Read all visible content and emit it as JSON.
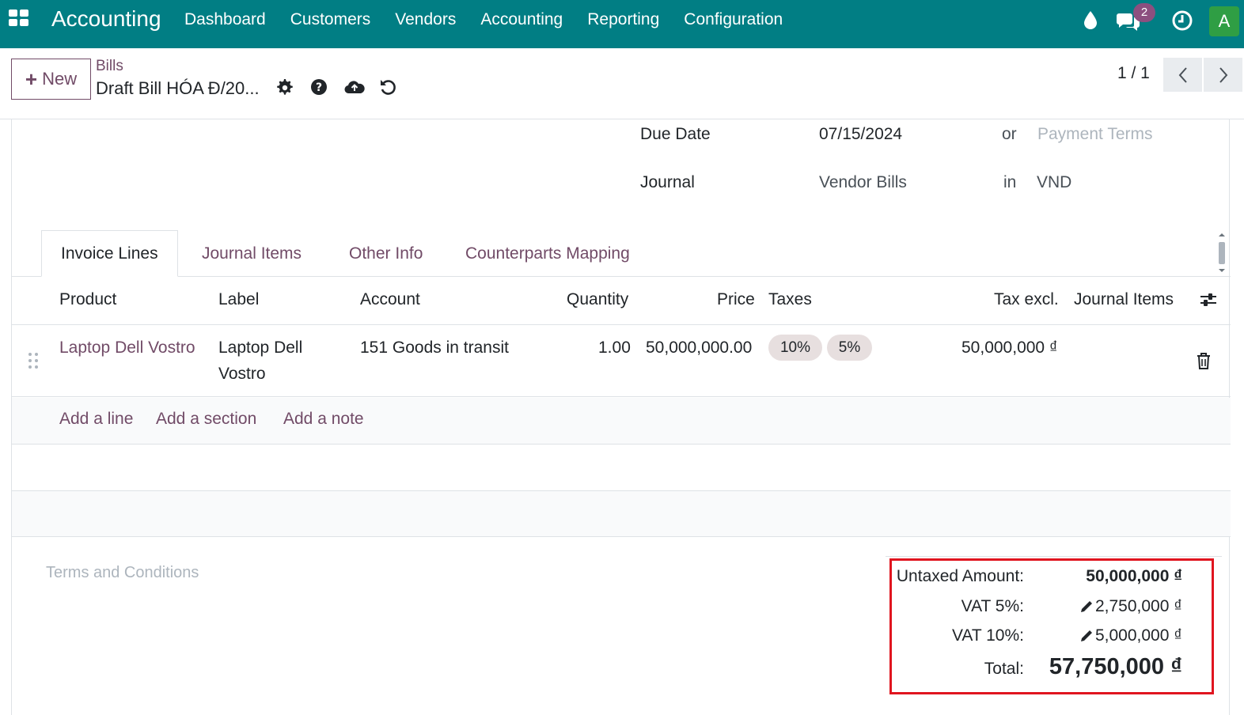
{
  "navbar": {
    "app_title": "Accounting",
    "menu": [
      "Dashboard",
      "Customers",
      "Vendors",
      "Accounting",
      "Reporting",
      "Configuration"
    ],
    "chat_count": "2",
    "avatar_letter": "A",
    "color": "#017e84"
  },
  "control_panel": {
    "new_label": "New",
    "breadcrumb_parent": "Bills",
    "breadcrumb_current": "Draft Bill HÓA Đ/20...",
    "pager": "1 / 1",
    "icons": [
      "gear-icon",
      "help-icon",
      "cloud-upload-icon",
      "undo-icon"
    ]
  },
  "header_fields": {
    "due_date_label": "Due Date",
    "due_date_value": "07/15/2024",
    "or_label": "or",
    "payment_terms_placeholder": "Payment Terms",
    "journal_label": "Journal",
    "journal_value": "Vendor Bills",
    "in_label": "in",
    "currency_value": "VND"
  },
  "tabs": [
    "Invoice Lines",
    "Journal Items",
    "Other Info",
    "Counterparts Mapping"
  ],
  "table": {
    "headers": [
      "Product",
      "Label",
      "Account",
      "Quantity",
      "Price",
      "Taxes",
      "Tax excl.",
      "Journal Items"
    ],
    "rows": [
      {
        "product": "Laptop Dell Vostro",
        "label_line1": "Laptop Dell",
        "label_line2": "Vostro",
        "account": "151 Goods in transit",
        "quantity": "1.00",
        "price": "50,000,000.00",
        "taxes": [
          "10%",
          "5%"
        ],
        "tax_excl": "50,000,000 ₫"
      }
    ],
    "add_links": [
      "Add a line",
      "Add a section",
      "Add a note"
    ]
  },
  "terms_placeholder": "Terms and Conditions",
  "totals": {
    "untaxed_label": "Untaxed Amount:",
    "untaxed_value": "50,000,000 ₫",
    "vat5_label": "VAT 5%:",
    "vat5_value": "2,750,000 ₫",
    "vat10_label": "VAT 10%:",
    "vat10_value": "5,000,000 ₫",
    "total_label": "Total:",
    "total_value": "57,750,000 ₫",
    "highlight_color": "#e0151f"
  },
  "accent_color": "#714b67"
}
